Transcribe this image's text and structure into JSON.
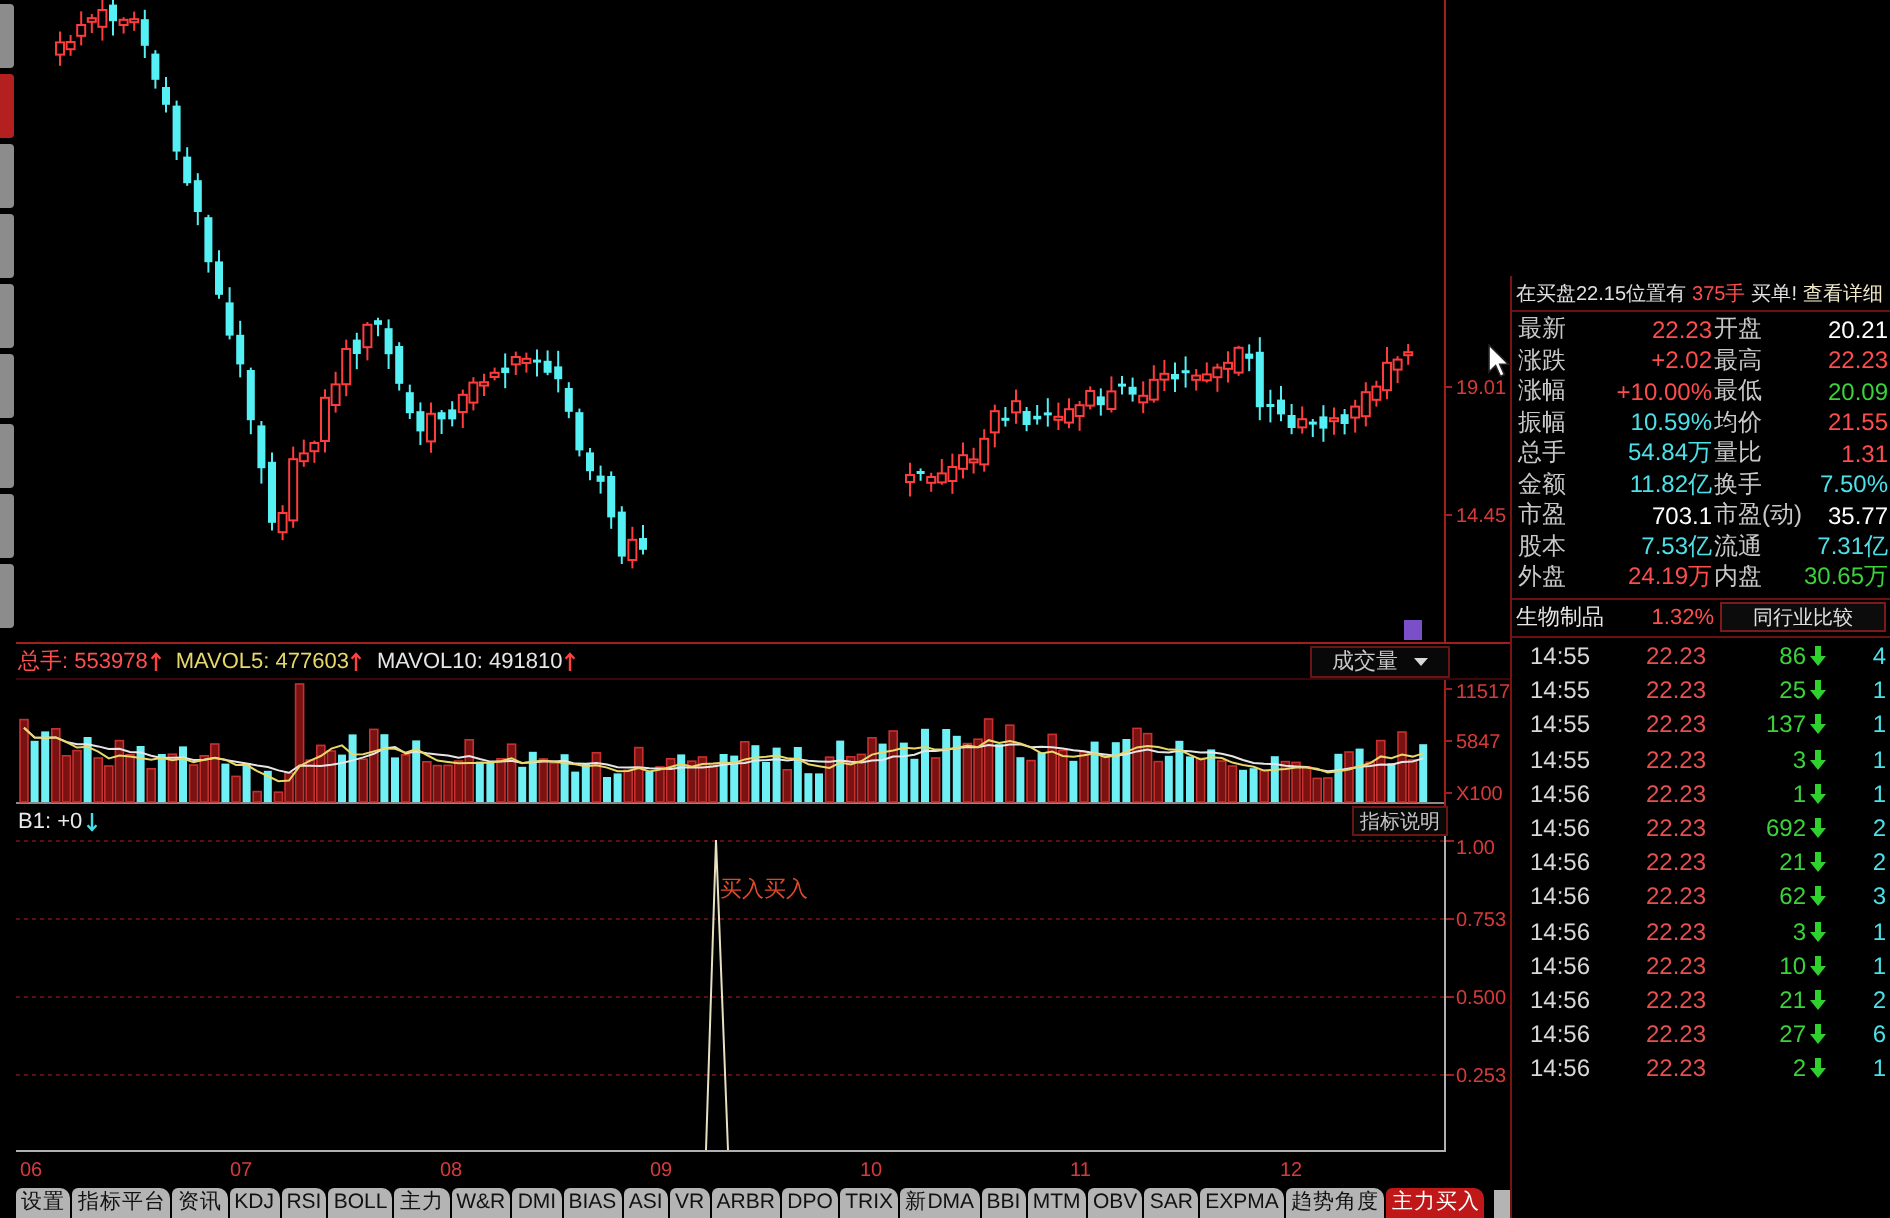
{
  "side_tabs": [
    {
      "selected": false
    },
    {
      "selected": true
    },
    {
      "selected": false
    },
    {
      "selected": false
    },
    {
      "selected": false
    },
    {
      "selected": false
    },
    {
      "selected": false
    },
    {
      "selected": false
    },
    {
      "selected": false
    }
  ],
  "price_chart": {
    "axis_labels": [
      "19.01",
      "14.45"
    ]
  },
  "volume_header": [
    {
      "text": "总手: 553978",
      "color": "#ff5050",
      "rising": true
    },
    {
      "text": "MAVOL5: 477603",
      "color": "#e8d86a",
      "rising": true
    },
    {
      "text": "MAVOL10: 491810",
      "color": "#e6e6e6",
      "rising": true
    }
  ],
  "volume_dropdown": {
    "label": "成交量"
  },
  "volume_chart": {
    "axis_labels": [
      "11517",
      "5847",
      "X100"
    ]
  },
  "indicator_header": {
    "text": "B1: +0",
    "rising": false
  },
  "indicator_button": {
    "label": "指标说明"
  },
  "indicator_chart": {
    "signal_label": "买入买入",
    "axis_labels": [
      "1.00",
      "0.753",
      "0.500",
      "0.253"
    ]
  },
  "date_axis": [
    "06",
    "07",
    "08",
    "09",
    "10",
    "11",
    "12"
  ],
  "tabs": [
    {
      "label": "设置",
      "selected": false
    },
    {
      "label": "指标平台",
      "selected": false
    },
    {
      "label": "资讯",
      "selected": false
    },
    {
      "label": "KDJ",
      "selected": false
    },
    {
      "label": "RSI",
      "selected": false
    },
    {
      "label": "BOLL",
      "selected": false
    },
    {
      "label": "主力",
      "selected": false
    },
    {
      "label": "W&R",
      "selected": false
    },
    {
      "label": "DMI",
      "selected": false
    },
    {
      "label": "BIAS",
      "selected": false
    },
    {
      "label": "ASI",
      "selected": false
    },
    {
      "label": "VR",
      "selected": false
    },
    {
      "label": "ARBR",
      "selected": false
    },
    {
      "label": "DPO",
      "selected": false
    },
    {
      "label": "TRIX",
      "selected": false
    },
    {
      "label": "新DMA",
      "selected": false
    },
    {
      "label": "BBI",
      "selected": false
    },
    {
      "label": "MTM",
      "selected": false
    },
    {
      "label": "OBV",
      "selected": false
    },
    {
      "label": "SAR",
      "selected": false
    },
    {
      "label": "EXPMA",
      "selected": false
    },
    {
      "label": "趋势角度",
      "selected": false
    },
    {
      "label": "主力买入",
      "selected": true
    }
  ],
  "quote": {
    "notice": {
      "text": "在买盘22.15位置有",
      "lots": "375手",
      "suffix": "买单!",
      "link": "查看详细"
    },
    "rows": [
      {
        "cells": [
          {
            "label": "最新",
            "value": "22.23",
            "color": "#ff4d4d"
          },
          {
            "label": "开盘",
            "value": "20.21",
            "color": "#ffffff"
          }
        ]
      },
      {
        "cells": [
          {
            "label": "涨跌",
            "value": "+2.02",
            "color": "#ff4d4d"
          },
          {
            "label": "最高",
            "value": "22.23",
            "color": "#ff4d4d"
          }
        ]
      },
      {
        "cells": [
          {
            "label": "涨幅",
            "value": "+10.00%",
            "color": "#ff4d4d"
          },
          {
            "label": "最低",
            "value": "20.09",
            "color": "#3cd23c"
          }
        ]
      },
      {
        "cells": [
          {
            "label": "振幅",
            "value": "10.59%",
            "color": "#4ee0e8"
          },
          {
            "label": "均价",
            "value": "21.55",
            "color": "#ff4d4d"
          }
        ]
      },
      {
        "cells": [
          {
            "label": "总手",
            "value": "54.84万",
            "color": "#4ee0e8"
          },
          {
            "label": "量比",
            "value": "1.31",
            "color": "#ff4d4d"
          }
        ]
      },
      {
        "cells": [
          {
            "label": "金额",
            "value": "11.82亿",
            "color": "#4ee0e8"
          },
          {
            "label": "换手",
            "value": "7.50%",
            "color": "#4ee0e8"
          }
        ]
      },
      {
        "cells": [
          {
            "label": "市盈",
            "value": "703.1",
            "color": "#ffffff"
          },
          {
            "label": "市盈(动)",
            "value": "35.77",
            "color": "#ffffff"
          }
        ]
      },
      {
        "cells": [
          {
            "label": "股本",
            "value": "7.53亿",
            "color": "#4ee0e8"
          },
          {
            "label": "流通",
            "value": "7.31亿",
            "color": "#4ee0e8"
          }
        ]
      },
      {
        "cells": [
          {
            "label": "外盘",
            "value": "24.19万",
            "color": "#ff4d4d"
          },
          {
            "label": "内盘",
            "value": "30.65万",
            "color": "#3cd23c"
          }
        ]
      }
    ]
  },
  "sector": {
    "name": "生物制品",
    "change": "1.32%",
    "button": "同行业比较"
  },
  "trades": [
    {
      "time": "14:55",
      "price": "22.23",
      "volume": "86",
      "rising": false,
      "column_4": "4"
    },
    {
      "time": "14:55",
      "price": "22.23",
      "volume": "25",
      "rising": false,
      "column_4": "1"
    },
    {
      "time": "14:55",
      "price": "22.23",
      "volume": "137",
      "rising": false,
      "column_4": "1"
    },
    {
      "time": "14:55",
      "price": "22.23",
      "volume": "3",
      "rising": false,
      "column_4": "1"
    },
    {
      "time": "14:56",
      "price": "22.23",
      "volume": "1",
      "rising": false,
      "column_4": "1"
    },
    {
      "time": "14:56",
      "price": "22.23",
      "volume": "692",
      "rising": false,
      "column_4": "2"
    },
    {
      "time": "14:56",
      "price": "22.23",
      "volume": "21",
      "rising": false,
      "column_4": "2"
    },
    {
      "time": "14:56",
      "price": "22.23",
      "volume": "62",
      "rising": false,
      "column_4": "3"
    },
    {
      "time": "14:56",
      "price": "22.23",
      "volume": "3",
      "rising": false,
      "column_4": "1"
    },
    {
      "time": "14:56",
      "price": "22.23",
      "volume": "10",
      "rising": false,
      "column_4": "1"
    },
    {
      "time": "14:56",
      "price": "22.23",
      "volume": "21",
      "rising": false,
      "column_4": "2"
    },
    {
      "time": "14:56",
      "price": "22.23",
      "volume": "27",
      "rising": false,
      "column_4": "6"
    },
    {
      "time": "14:56",
      "price": "22.23",
      "volume": "2",
      "rising": false,
      "column_4": "1"
    }
  ]
}
